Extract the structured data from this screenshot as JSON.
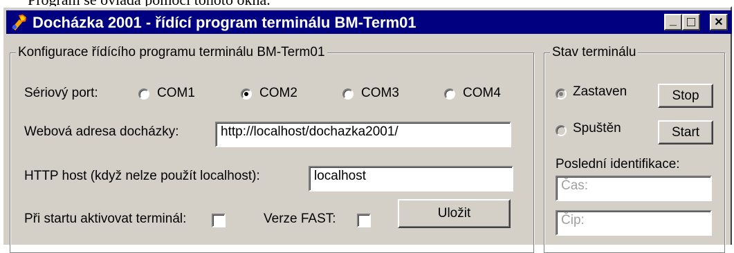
{
  "window": {
    "title": "Docházka 2001 - řídící program terminálu BM-Term01",
    "buttons": {
      "minimize": "_",
      "maximize": "□",
      "close": "✕"
    }
  },
  "config": {
    "title": "Konfigurace řídícího programu terminálu BM-Term01",
    "serial_label": "Sériový port:",
    "ports": [
      {
        "label": "COM1",
        "selected": false
      },
      {
        "label": "COM2",
        "selected": true
      },
      {
        "label": "COM3",
        "selected": false
      },
      {
        "label": "COM4",
        "selected": false
      }
    ],
    "web_label": "Webová adresa docházky:",
    "web_value": "http://localhost/dochazka2001/",
    "host_label": "HTTP host (když nelze použít localhost):",
    "host_value": "localhost",
    "startup_label": "Při startu aktivovat terminál:",
    "startup_checked": false,
    "fast_label": "Verze FAST:",
    "fast_checked": false,
    "save_label": "Uložit"
  },
  "status": {
    "title": "Stav terminálu",
    "stopped_label": "Zastaven",
    "stopped_selected": true,
    "running_label": "Spuštěn",
    "running_selected": false,
    "stop_label": "Stop",
    "start_label": "Start",
    "last_id_label": "Poslední identifikace:",
    "time_placeholder": "Čas:",
    "chip_placeholder": "Čip:"
  }
}
